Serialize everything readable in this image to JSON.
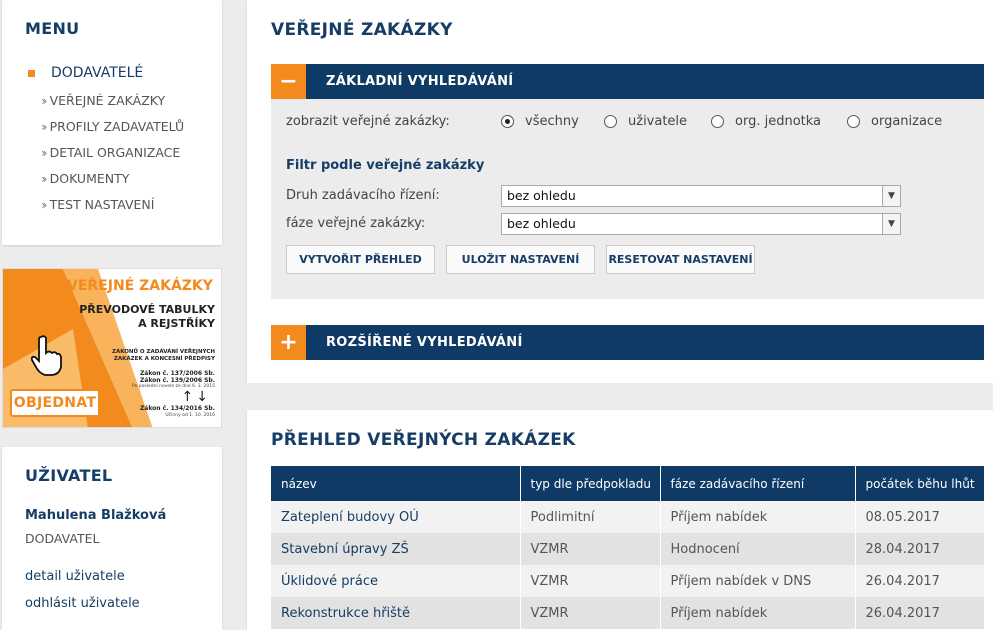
{
  "menu": {
    "title": "MENU",
    "primary": "DODAVATELÉ",
    "items": [
      {
        "label": "VEŘEJNÉ ZAKÁZKY"
      },
      {
        "label": "PROFILY ZADAVATELŮ"
      },
      {
        "label": "DETAIL ORGANIZACE"
      },
      {
        "label": "DOKUMENTY"
      },
      {
        "label": "TEST NASTAVENÍ"
      }
    ]
  },
  "banner": {
    "title": "VEŘEJNÉ ZAKÁZKY",
    "subtitle_1": "PŘEVODOVÉ TABULKY",
    "subtitle_2": "A REJSTŘÍKY",
    "small_1": "ZÁKONŮ O ZADÁVÁNÍ VEŘEJNÝCH",
    "small_2": "ZAKÁZEK A KONCESNÍ PŘEDPISY",
    "law_1": "Zákon č. 137/2006 Sb.",
    "law_2": "Zákon č. 139/2006 Sb.",
    "law_note": "Po poslední novele ze dne 6. 3. 2015",
    "law_3": "Zákon č. 134/2016 Sb.",
    "law_3_note": "Účinný od 1. 10. 2016",
    "arrows": "↑↓",
    "button": "OBJEDNAT",
    "accent_color": "#f28a1e"
  },
  "user": {
    "title": "UŽIVATEL",
    "name": "Mahulena Blažková",
    "role": "DODAVATEL",
    "detail_link": "detail uživatele",
    "logout_link": "odhlásit uživatele"
  },
  "page": {
    "title": "VEŘEJNÉ ZAKÁZKY"
  },
  "basic_search": {
    "toggle": "−",
    "label": "ZÁKLADNÍ VYHLEDÁVÁNÍ",
    "show_label": "zobrazit veřejné zakázky:",
    "radios": [
      {
        "label": "všechny",
        "selected": true
      },
      {
        "label": "uživatele",
        "selected": false
      },
      {
        "label": "org. jednotka",
        "selected": false
      },
      {
        "label": "organizace",
        "selected": false
      }
    ],
    "filter_heading": "Filtr podle veřejné zakázky",
    "procedure_label": "Druh zadávacího řízení:",
    "procedure_value": "bez ohledu",
    "phase_label": "fáze veřejné zakázky:",
    "phase_value": "bez ohledu",
    "btn_create": "VYTVOŘIT PŘEHLED",
    "btn_save": "ULOŽIT NASTAVENÍ",
    "btn_reset": "RESETOVAT NASTAVENÍ"
  },
  "advanced_search": {
    "toggle": "+",
    "label": "ROZŠÍŘENÉ VYHLEDÁVÁNÍ"
  },
  "overview": {
    "title": "PŘEHLED VEŘEJNÝCH ZAKÁZEK",
    "columns": [
      "název",
      "typ dle předpokladu",
      "fáze zadávacího řízení",
      "počátek běhu lhůt"
    ],
    "rows": [
      {
        "name": "Zateplení budovy OÚ",
        "type": "Podlimitní",
        "phase": "Příjem nabídek",
        "date": "08.05.2017"
      },
      {
        "name": "Stavební úpravy ZŠ",
        "type": "VZMR",
        "phase": "Hodnocení",
        "date": "28.04.2017"
      },
      {
        "name": "Úklidové práce",
        "type": "VZMR",
        "phase": "Příjem nabídek v DNS",
        "date": "26.04.2017"
      },
      {
        "name": "Rekonstrukce hřiště",
        "type": "VZMR",
        "phase": "Příjem nabídek",
        "date": "26.04.2017"
      }
    ]
  },
  "colors": {
    "navy": "#0f3a66",
    "orange": "#f28a1e",
    "background": "#ececec"
  }
}
